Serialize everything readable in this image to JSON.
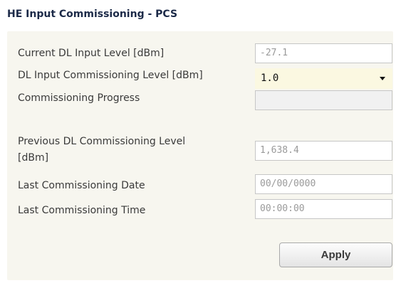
{
  "header": {
    "title": "HE Input Commissioning - PCS"
  },
  "form": {
    "current_dl_input_level": {
      "label": "Current DL Input Level [dBm]",
      "value": "-27.1"
    },
    "dl_input_commissioning_level": {
      "label": "DL Input Commissioning Level [dBm]",
      "selected": "1.0"
    },
    "commissioning_progress": {
      "label": "Commissioning Progress",
      "value": ""
    },
    "previous_dl_commissioning_level": {
      "label_line1": "Previous DL Commissioning Level",
      "label_line2": "[dBm]",
      "value": "1,638.4"
    },
    "last_commissioning_date": {
      "label": "Last Commissioning Date",
      "value": "00/00/0000"
    },
    "last_commissioning_time": {
      "label": "Last Commissioning Time",
      "value": "00:00:00"
    },
    "apply_label": "Apply"
  },
  "icons": {
    "dropdown": "chevron-down-icon"
  },
  "colors": {
    "title": "#1c2a48",
    "panel_background": "#f7f6ef",
    "select_background": "#fbf8e1"
  }
}
